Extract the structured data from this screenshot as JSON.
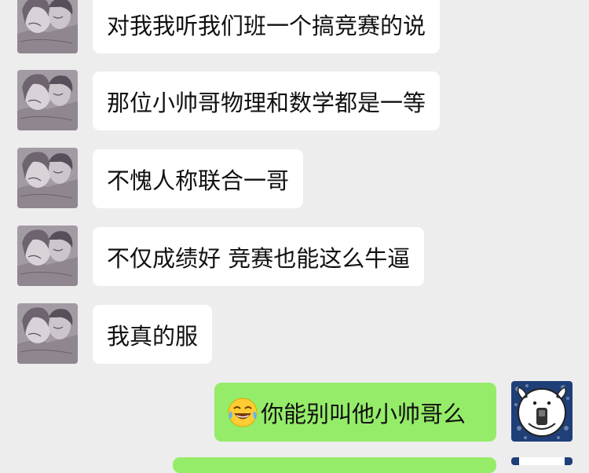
{
  "messages": [
    {
      "side": "left",
      "text": "对我我听我们班一个搞竞赛的说"
    },
    {
      "side": "left",
      "text": "那位小帅哥物理和数学都是一等"
    },
    {
      "side": "left",
      "text": "不愧人称联合一哥"
    },
    {
      "side": "left",
      "text": "不仅成绩好 竞赛也能这么牛逼"
    },
    {
      "side": "left",
      "text": "我真的服"
    },
    {
      "side": "right",
      "emoji": "face-with-tears-of-joy-icon",
      "text": "你能别叫他小帅哥么"
    }
  ],
  "colors": {
    "background": "#ededed",
    "incoming_bubble": "#ffffff",
    "outgoing_bubble": "#95ec69",
    "text": "#111111"
  }
}
